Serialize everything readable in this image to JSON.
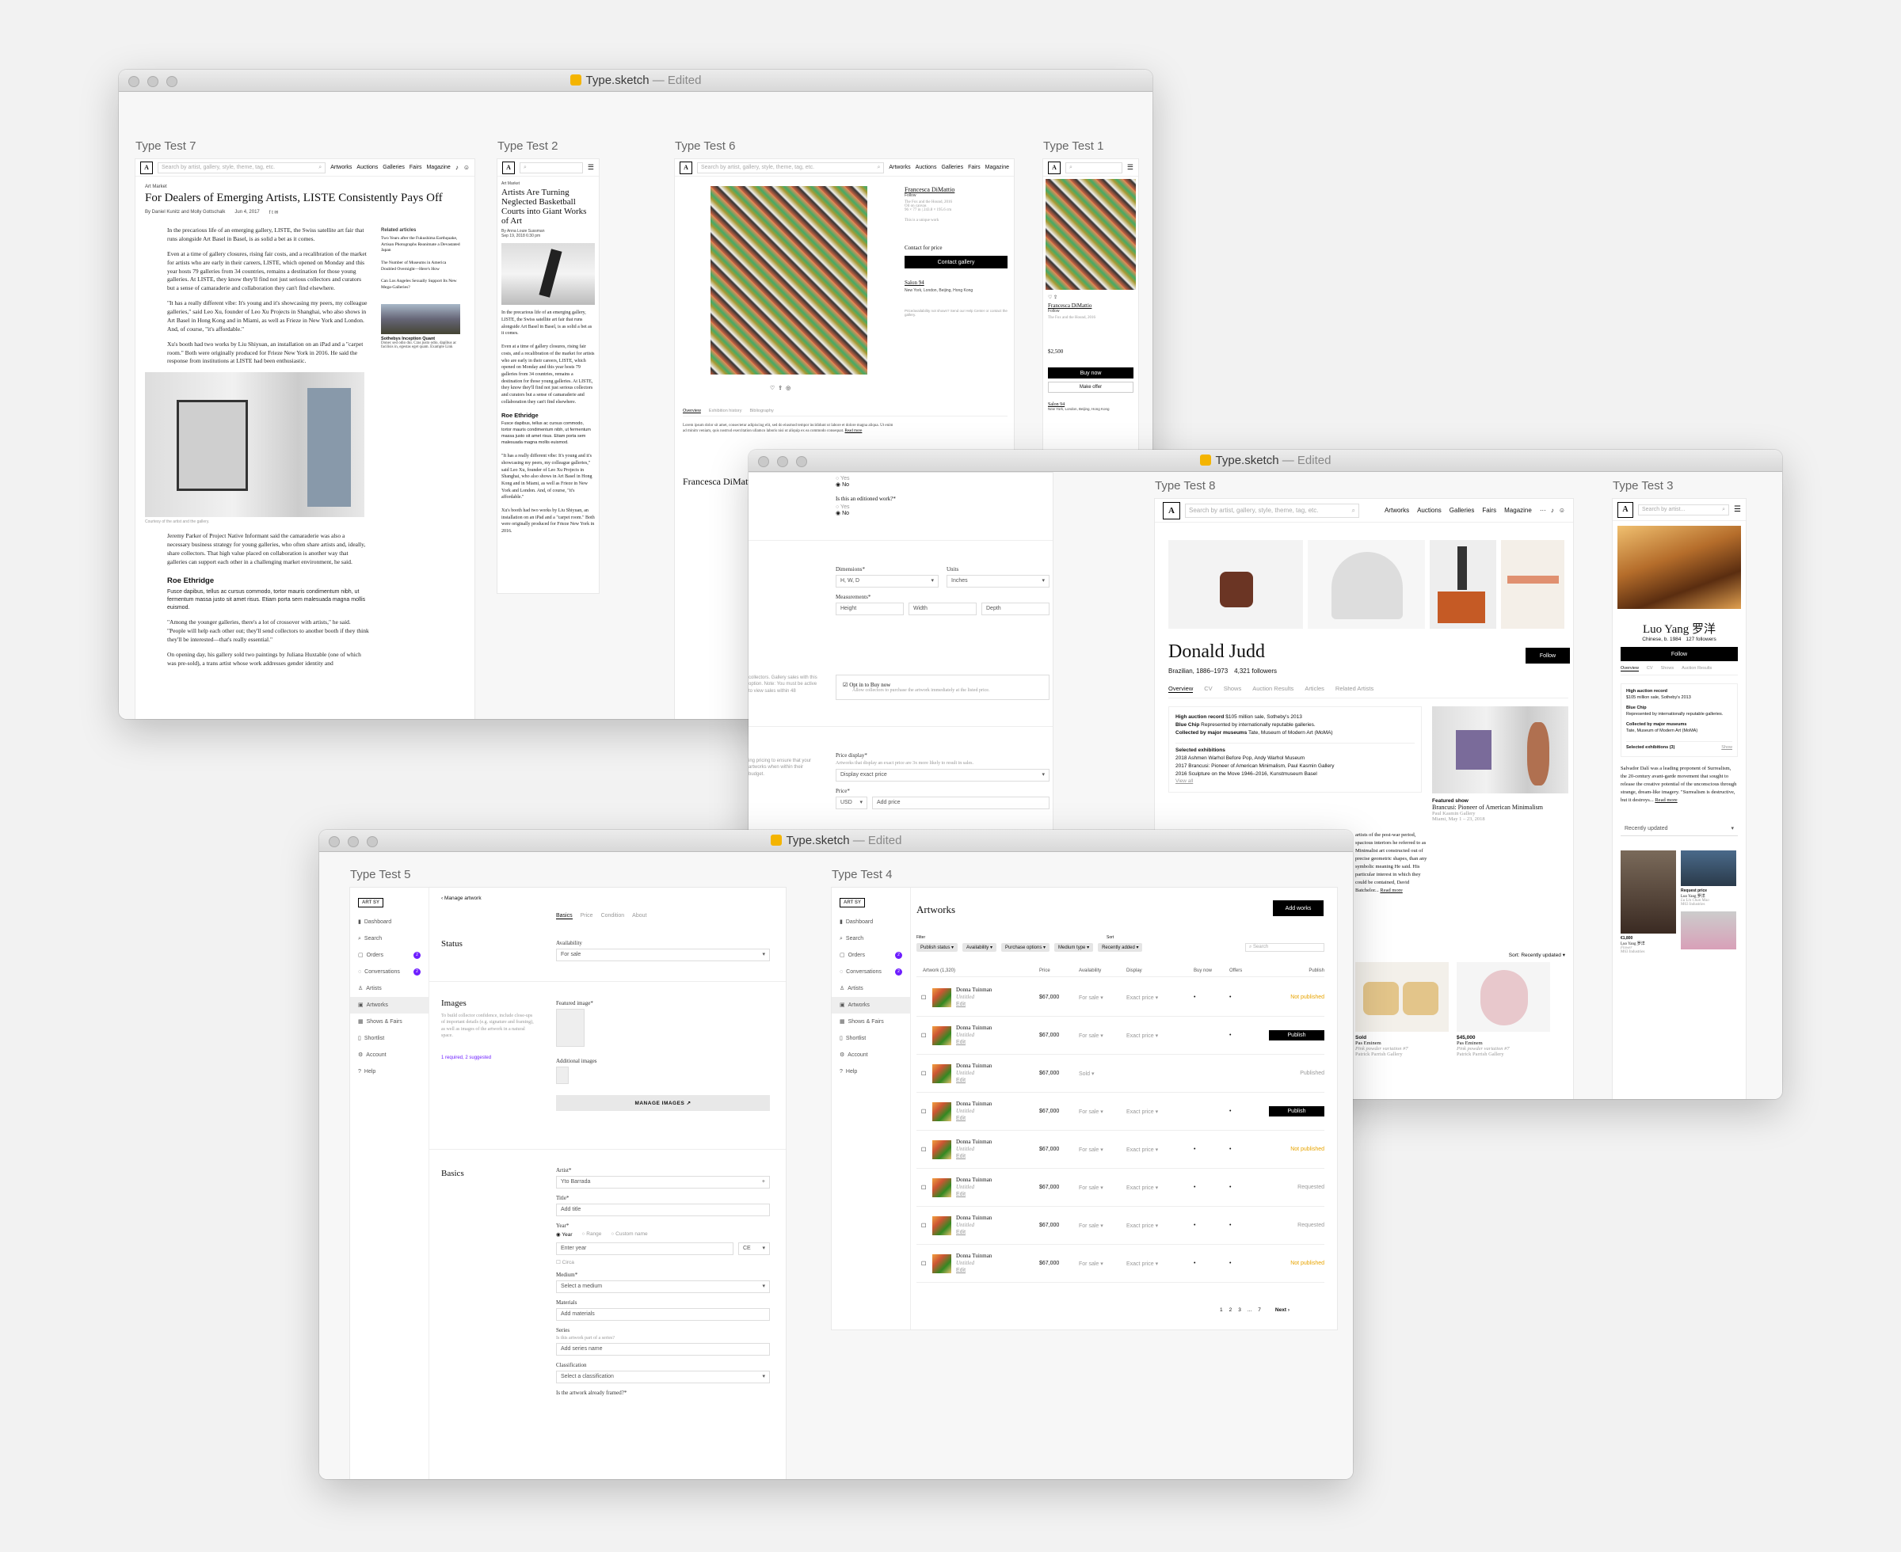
{
  "app": {
    "name": "Type.sketch",
    "state": "— Edited"
  },
  "w1": {
    "tt7": {
      "label": "Type Test 7",
      "nav": [
        "Artworks",
        "Auctions",
        "Galleries",
        "Fairs",
        "Magazine"
      ],
      "search": "Search by artist, gallery, style, theme, tag, etc.",
      "kicker": "Art Market",
      "title": "For Dealers of Emerging Artists, LISTE Consistently Pays Off",
      "byline": "By Daniel Kunitz and Molly Gottschalk",
      "date": "Jun 4, 2017",
      "paras": [
        "In the precarious life of an emerging gallery, LISTE, the Swiss satellite art fair that runs alongside Art Basel in Basel, is as solid a bet as it comes.",
        "Even at a time of gallery closures, rising fair costs, and a recalibration of the market for artists who are early in their careers, LISTE, which opened on Monday and this year hosts 79 galleries from 34 countries, remains a destination for those young galleries. At LISTE, they know they'll find not just serious collectors and curators but a sense of camaraderie and collaboration they can't find elsewhere.",
        "\"It has a really different vibe: It's young and it's showcasing my peers, my colleague galleries,\" said Leo Xu, founder of Leo Xu Projects in Shanghai, who also shows in Art Basel in Hong Kong and in Miami, as well as Frieze in New York and London. And, of course, \"it's affordable.\"",
        "Xu's booth had two works by Liu Shiyuan, an installation on an iPad and a \"carpet room.\" Both were originally produced for Frieze New York in 2016. He said the response from institutions at LISTE had been enthusiastic."
      ],
      "caption": "Courtesy of the artist and the gallery.",
      "paras2": [
        "Jeremy Parker of Project Native Informant said the camaraderie was also a necessary business strategy for young galleries, who often share artists and, ideally, share collectors. That high value placed on collaboration is another way that galleries can support each other in a challenging market environment, he said."
      ],
      "h2": "Roe Ethridge",
      "lorem": "Fusce dapibus, tellus ac cursus commodo, tortor mauris condimentum nibh, ut fermentum massa justo sit amet risus. Etiam porta sem malesuada magna mollis euismod.",
      "paras3": [
        "\"Among the younger galleries, there's a lot of crossover with artists,\" he said. \"People will help each other out; they'll send collectors to another booth if they think they'll be interested—that's really essential.\"",
        "On opening day, his gallery sold two paintings by Juliana Huxtable (one of which was pre-sold), a trans artist whose work addresses gender identity and"
      ],
      "related": {
        "title": "Related articles",
        "items": [
          "Two Years after the Fukushima Earthquake, Artisan Photographs Reanimate a Devastated Japan",
          "The Number of Museums in America Doubled Overnight—Here's How",
          "Can Los Angeles Sexually Support Its New Mega-Galleries?"
        ],
        "card": {
          "title": "Sothebys Inception Quant",
          "text": "Donec sed odio dui. Cras justo odio, dapibus ac facilisis in, egestas eget quam. Example Link"
        }
      }
    },
    "tt2": {
      "label": "Type Test 2",
      "kicker": "Art Market",
      "title": "Artists Are Turning Neglected Basketball Courts into Giant Works of Art",
      "byline": "By Anna Louie Sussman",
      "date": "Sep 19, 2018 6:30 pm",
      "paras": [
        "In the precarious life of an emerging gallery, LISTE, the Swiss satellite art fair that runs alongside Art Basel in Basel, is as solid a bet as it comes.",
        "Even at a time of gallery closures, rising fair costs, and a recalibration of the market for artists who are early in their careers, LISTE, which opened on Monday and this year hosts 79 galleries from 34 countries, remains a destination for those young galleries. At LISTE, they know they'll find not just serious collectors and curators but a sense of camaraderie and collaboration they can't find elsewhere."
      ],
      "h2": "Roe Ethridge",
      "lorem": "Fusce dapibus, tellus ac cursus commodo, tortor mauris condimentum nibh, ut fermentum massa justo sit amet risus. Etiam porta sem malesuada magna mollis euismod.",
      "paras2": [
        "\"It has a really different vibe: It's young and it's showcasing my peers, my colleague galleries,\" said Leo Xu, founder of Leo Xu Projects in Shanghai, who also shows in Art Basel in Hong Kong and in Miami, as well as Frieze in New York and London. And, of course, \"it's affordable.\"",
        "Xu's booth had two works by Liu Shiyuan, an installation on an iPad and a \"carpet room.\" Both were originally produced for Frieze New York in 2016."
      ]
    },
    "tt6": {
      "label": "Type Test 6",
      "artist": "Francesca DiMattio",
      "follow": "Follow",
      "title": "The Fox and the Hound, 2016",
      "meta": [
        "Oil on canvas",
        "96 × 77 in | 243.8 × 195.6 cm",
        "This is a unique work"
      ],
      "contact_label": "Contact for price",
      "contact_btn": "Contact gallery",
      "gallery": "Salon 94",
      "locations": "New York, London, Beijing, Hong Kong",
      "fine": "Price/availability not shown? Send our Help Center or contact the gallery.",
      "tabs": [
        "Overview",
        "Exhibition history",
        "Bibliography"
      ],
      "desc": "Lorem ipsum dolor sit amet, consectetur adipiscing elit, sed do eiusmod tempor incididunt ut labore et dolore magna aliqua. Ut enim ad minim veniam, quis nostrud exercitation ullamco laboris nisi ut aliquip ex ea commodo consequat.",
      "read_more": "Read more",
      "bio_title": "Francesca DiMattio"
    },
    "tt1": {
      "label": "Type Test 1",
      "artist": "Francesca DiMattio",
      "follow": "Follow",
      "title": "The Fox and the Hound, 2016",
      "price": "$2,500",
      "buy": "Buy now",
      "offer": "Make offer",
      "gallery": "Salon 94",
      "loc": "New York, London, Beijing, Hong Kong"
    }
  },
  "w2": {
    "form": {
      "yes": "Yes",
      "no": "No",
      "edition_q": "Is this an editioned work?*",
      "dims": "Dimensions*",
      "dims_val": "H, W, D",
      "units": "Units",
      "units_val": "Inches",
      "meas": "Measurements*",
      "h": "Height",
      "w": "Width",
      "d": "Depth",
      "buy_title": "Opt in to Buy now",
      "buy_text": "Allow collectors to purchase the artwork immediately at the listed price.",
      "left_text": "collectors. Gallery sales with this option. Note: You must be active to view sales within 48",
      "left_text2": "ing pricing to ensure that your artworks when within their budget.",
      "pd_label": "Price display*",
      "pd_help": "Artworks that display an exact price are 3x more likely to result in sales.",
      "pd_val": "Display exact price",
      "price_label": "Price*",
      "cur": "USD",
      "price_ph": "Add price"
    },
    "tt8": {
      "label": "Type Test 8",
      "nav": [
        "Artworks",
        "Auctions",
        "Galleries",
        "Fairs",
        "Magazine"
      ],
      "search": "Search by artist, gallery, style, theme, tag, etc.",
      "name": "Donald Judd",
      "meta": "Brazilian, 1886–1973",
      "followers": "4,321 followers",
      "follow": "Follow",
      "tabs": [
        "Overview",
        "CV",
        "Shows",
        "Auction Results",
        "Articles",
        "Related Artists"
      ],
      "career": [
        {
          "k": "High auction record",
          "v": "$105 million sale, Sotheby's 2013"
        },
        {
          "k": "Blue Chip",
          "v": "Represented by internationally reputable galleries."
        },
        {
          "k": "Collected by major museums",
          "v": "Tate, Museum of Modern Art (MoMA)"
        }
      ],
      "exh_title": "Selected exhibitions",
      "exh": [
        "2018  Ashmen Warhol Before Pop, Andy Warhol Museum",
        "2017  Brancusi: Pioneer of American Minimalism, Paul Kasmin Gallery",
        "2016  Sculpture on the Move 1946–2016, Kunstmuseum Basel"
      ],
      "view_all": "View all",
      "featured_kicker": "Featured show",
      "featured_title": "Brancusi: Pioneer of American Minimalism",
      "featured_gallery": "Paul Kasmin Gallery",
      "featured_dates": "Miami, May 1 – 23, 2018",
      "bio": "artists of the post-war period, spacious interiors he referred to as Minimalist art constructed out of precise geometric shapes, than any symbolic meaning He said. His particular interest in which they could be contained, David Batchelor...",
      "read_more": "Read more",
      "sort": "Sort: Recently updated",
      "works": [
        {
          "status": "Sold",
          "artist": "Pas Eminem",
          "title": "Pink powder variation #7",
          "gallery": "Patrick Parrish Gallery"
        },
        {
          "status": "$45,000",
          "artist": "Pas Eminem",
          "title": "Pink powder variation #7",
          "gallery": "Patrick Parrish Gallery"
        }
      ]
    },
    "tt3": {
      "label": "Type Test 3",
      "search": "Search by artist...",
      "name": "Luo Yang 罗洋",
      "meta": "Chinese, b. 1984",
      "followers": "127 followers",
      "follow": "Follow",
      "tabs": [
        "Overview",
        "CV",
        "Shows",
        "Auction Results"
      ],
      "career": [
        {
          "k": "High auction record",
          "v": "$105 million sale, Sotheby's 2013"
        },
        {
          "k": "Blue Chip",
          "v": "Represented by internationally reputable galleries."
        },
        {
          "k": "Collected by major museums",
          "v": "Tate, Museum of Modern Art (MoMA)"
        }
      ],
      "exh": "Selected exhibitions (3)",
      "show": "Show",
      "bio": "Salvador Dalí was a leading proponent of Surrealism, the 20-century avant-garde movement that sought to release the creative potential of the unconscious through strange, dream-like imagery. \"Surrealism is destructive, but it destroys...",
      "read_more": "Read more",
      "sort": "Recently updated",
      "w1": {
        "price": "€1,800",
        "artist": "Luo Yang 罗洋",
        "title": "Flower",
        "gallery": "M63 Industries"
      },
      "w2": {
        "price": "Request price",
        "artist": "Luo Yang 罗洋",
        "title": "Lu Lin Chun Mao",
        "gallery": "M63 Industries"
      }
    }
  },
  "w3": {
    "sidebar": {
      "logo": "ART SY",
      "items": [
        {
          "label": "Dashboard",
          "icon": "chart-icon"
        },
        {
          "label": "Search",
          "icon": "search-icon"
        },
        {
          "label": "Orders",
          "icon": "box-icon",
          "badge": "2"
        },
        {
          "label": "Conversations",
          "icon": "chat-icon",
          "badge": "2"
        },
        {
          "label": "Artists",
          "icon": "person-icon"
        },
        {
          "label": "Artworks",
          "icon": "frame-icon"
        },
        {
          "label": "Shows & Fairs",
          "icon": "calendar-icon"
        },
        {
          "label": "Shortlist",
          "icon": "bookmark-icon"
        },
        {
          "label": "Account",
          "icon": "gear-icon"
        },
        {
          "label": "Help",
          "icon": "help-icon"
        }
      ]
    },
    "tt5": {
      "label": "Type Test 5",
      "back": "‹ Manage artwork",
      "tabs": [
        "Basics",
        "Price",
        "Condition",
        "About"
      ],
      "status": "Status",
      "avail": "Availability",
      "avail_val": "For sale",
      "images": "Images",
      "images_help": "To build collector confidence, include close-ups of important details (e.g. signature and framing), as well as images of the artwork in a natural space.",
      "images_link": "1 required, 2 suggested",
      "featured": "Featured image*",
      "additional": "Additional images",
      "manage": "MANAGE IMAGES ↗",
      "basics": "Basics",
      "artist": "Artist*",
      "artist_val": "Yto Barrada",
      "title": "Title*",
      "title_ph": "Add title",
      "year": "Year*",
      "yopts": [
        "Year",
        "Range",
        "Custom name"
      ],
      "year_ph": "Enter year",
      "era": "CE",
      "circa": "Circa",
      "medium": "Medium*",
      "medium_val": "Select a medium",
      "materials": "Materials",
      "materials_ph": "Add materials",
      "series": "Series",
      "series_help": "Is this artwork part of a series?",
      "series_ph": "Add series name",
      "class": "Classification",
      "class_val": "Select a classification",
      "framed": "Is the artwork already framed?*"
    },
    "tt4": {
      "label": "Type Test 4",
      "heading": "Artworks",
      "add": "Add works",
      "filter_label": "Filter",
      "filters": [
        "Publish status",
        "Availability",
        "Purchase options",
        "Medium type"
      ],
      "sort_label": "Sort",
      "sort_val": "Recently added",
      "search_ph": "Search",
      "cols": [
        "Artwork (1,320)",
        "Price",
        "Availability",
        "Display",
        "Buy now",
        "Offers",
        "Publish"
      ],
      "rows": [
        {
          "artist": "Donna Tuinman",
          "title": "Untitled",
          "edit": "Edit",
          "price": "$67,000",
          "avail": "For sale",
          "display": "Exact price",
          "buy": "•",
          "offers": "•",
          "pub": "Not published",
          "pubtype": "warn"
        },
        {
          "artist": "Donna Tuinman",
          "title": "Untitled",
          "edit": "Edit",
          "price": "$67,000",
          "avail": "For sale",
          "display": "Exact price",
          "buy": "",
          "offers": "•",
          "pub": "Publish",
          "pubtype": "btn"
        },
        {
          "artist": "Donna Tuinman",
          "title": "Untitled",
          "edit": "Edit",
          "price": "$67,000",
          "avail": "Sold",
          "display": "",
          "buy": "",
          "offers": "",
          "pub": "Published",
          "pubtype": "text"
        },
        {
          "artist": "Donna Tuinman",
          "title": "Untitled",
          "edit": "Edit",
          "price": "$67,000",
          "avail": "For sale",
          "display": "Exact price",
          "buy": "",
          "offers": "•",
          "pub": "Publish",
          "pubtype": "btn"
        },
        {
          "artist": "Donna Tuinman",
          "title": "Untitled",
          "edit": "Edit",
          "price": "$67,000",
          "avail": "For sale",
          "display": "Exact price",
          "buy": "•",
          "offers": "•",
          "pub": "Not published",
          "pubtype": "warn"
        },
        {
          "artist": "Donna Tuinman",
          "title": "Untitled",
          "edit": "Edit",
          "price": "$67,000",
          "avail": "For sale",
          "display": "Exact price",
          "buy": "•",
          "offers": "•",
          "pub": "Requested",
          "pubtype": "text"
        },
        {
          "artist": "Donna Tuinman",
          "title": "Untitled",
          "edit": "Edit",
          "price": "$67,000",
          "avail": "For sale",
          "display": "Exact price",
          "buy": "•",
          "offers": "•",
          "pub": "Requested",
          "pubtype": "text"
        },
        {
          "artist": "Donna Tuinman",
          "title": "Untitled",
          "edit": "Edit",
          "price": "$67,000",
          "avail": "For sale",
          "display": "Exact price",
          "buy": "•",
          "offers": "•",
          "pub": "Not published",
          "pubtype": "warn"
        }
      ],
      "pages": [
        "1",
        "2",
        "3",
        "...",
        "7"
      ],
      "next": "Next"
    }
  }
}
